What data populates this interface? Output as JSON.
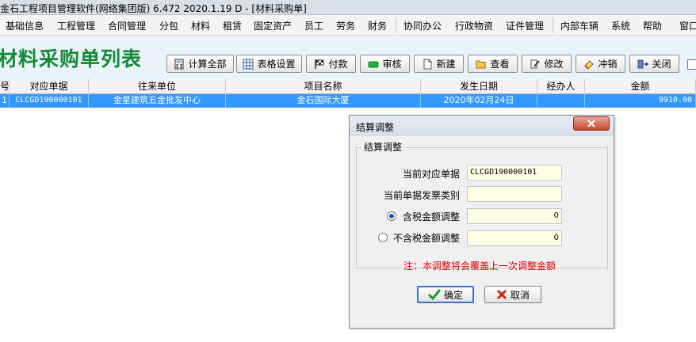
{
  "window": {
    "title": "金石工程项目管理软件(网络集团版) 6.472  2020.1.19 D - [材料采购单]"
  },
  "menu": [
    "基础信息",
    "工程管理",
    "合同管理",
    "分包",
    "材料",
    "租赁",
    "固定资产",
    "员工",
    "劳务",
    "财务",
    "协同办公",
    "行政物资",
    "证件管理",
    "内部车辆",
    "系统",
    "帮助",
    "窗口"
  ],
  "page": {
    "title": "材料采购单列表"
  },
  "toolbar": {
    "calc_all": "计算全部",
    "table_settings": "表格设置",
    "pay": "付款",
    "review": "审核",
    "new": "新建",
    "view": "查看",
    "edit": "修改",
    "reverse": "冲销",
    "close": "关闭"
  },
  "table": {
    "columns": [
      "号",
      "对应单据",
      "往来单位",
      "项目名称",
      "发生日期",
      "经办人",
      "金额"
    ],
    "rows": [
      {
        "no": "1",
        "doc": "CLCGD190000101",
        "partner": "金星建筑五金批发中心",
        "project": "金石国际大厦",
        "date": "2020年02月24日",
        "handler": "",
        "amount": "9910.00"
      }
    ]
  },
  "dialog": {
    "title": "结算调整",
    "group_label": "结算调整",
    "doc_label": "当前对应单据",
    "doc_value": "CLCGD190000101",
    "invoice_label": "当前单据发票类别",
    "invoice_value": "",
    "tax_incl_label": "含税金额调整",
    "tax_incl_value": "0",
    "tax_excl_label": "不含税金额调整",
    "tax_excl_value": "0",
    "selected_option": "tax_incl",
    "note": "注：本调整将会覆盖上一次调整金额",
    "ok_label": "确定",
    "cancel_label": "取消"
  },
  "colors": {
    "title_green": "#138a36",
    "selection_blue": "#3399ff",
    "note_red": "#e00000",
    "input_bg": "#ffffe6"
  }
}
